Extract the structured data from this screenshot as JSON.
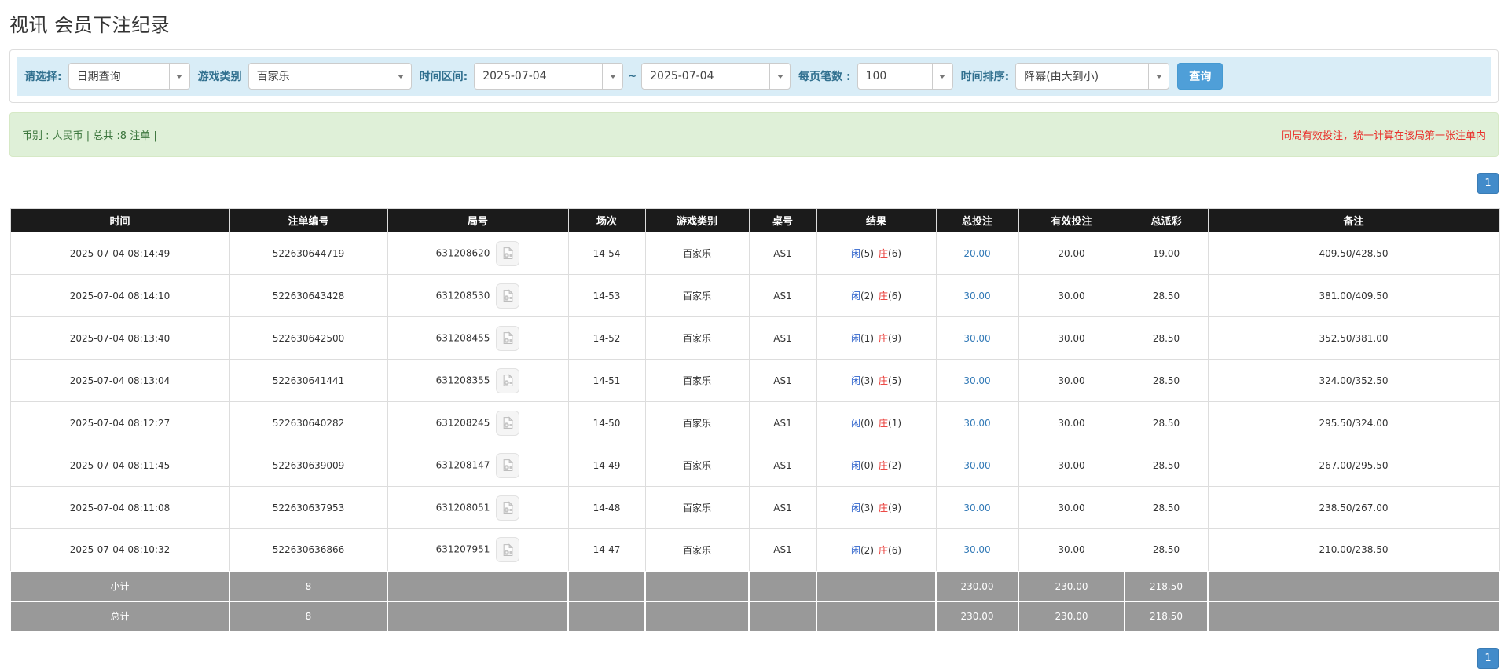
{
  "page": {
    "title": "视讯 会员下注纪录"
  },
  "filters": {
    "select_label": "请选择:",
    "select_value": "日期查询",
    "game_type_label": "游戏类别",
    "game_type_value": "百家乐",
    "time_range_label": "时间区间:",
    "date_from": "2025-07-04",
    "tilde": "~",
    "date_to": "2025-07-04",
    "page_size_label": "每页笔数 :",
    "page_size_value": "100",
    "sort_label": "时间排序:",
    "sort_value": "降幂(由大到小)",
    "search_button": "查询"
  },
  "summary_bar": {
    "left_text": "币别 : 人民币 | 总共 :8 注单 |",
    "right_text": "同局有效投注，统一计算在该局第一张注单内"
  },
  "pagination": {
    "page": "1"
  },
  "colors": {
    "accent_blue": "#4f9fd8",
    "pagination_blue": "#428bca",
    "filter_bar_bg": "#d9edf7",
    "filter_label": "#31708f",
    "success_bg": "#dff0d8",
    "success_text": "#3c763d",
    "notice_red": "#e9322d",
    "player_blue": "#3366cc",
    "banker_red": "#e9322d",
    "link_blue": "#337ab7",
    "table_header_bg": "#1b1b1b",
    "summary_row_bg": "#999999"
  },
  "table": {
    "headers": [
      "时间",
      "注单编号",
      "局号",
      "场次",
      "游戏类别",
      "桌号",
      "结果",
      "总投注",
      "有效投注",
      "总派彩",
      "备注"
    ],
    "rows": [
      {
        "time": "2025-07-04 08:14:49",
        "bet_id": "522630644719",
        "round_id": "631208620",
        "session": "14-54",
        "game": "百家乐",
        "table_no": "AS1",
        "player": "闲",
        "player_score": "(5)",
        "banker": "庄",
        "banker_score": "(6)",
        "total_bet": "20.00",
        "valid_bet": "20.00",
        "payout": "19.00",
        "remark": "409.50/428.50"
      },
      {
        "time": "2025-07-04 08:14:10",
        "bet_id": "522630643428",
        "round_id": "631208530",
        "session": "14-53",
        "game": "百家乐",
        "table_no": "AS1",
        "player": "闲",
        "player_score": "(2)",
        "banker": "庄",
        "banker_score": "(6)",
        "total_bet": "30.00",
        "valid_bet": "30.00",
        "payout": "28.50",
        "remark": "381.00/409.50"
      },
      {
        "time": "2025-07-04 08:13:40",
        "bet_id": "522630642500",
        "round_id": "631208455",
        "session": "14-52",
        "game": "百家乐",
        "table_no": "AS1",
        "player": "闲",
        "player_score": "(1)",
        "banker": "庄",
        "banker_score": "(9)",
        "total_bet": "30.00",
        "valid_bet": "30.00",
        "payout": "28.50",
        "remark": "352.50/381.00"
      },
      {
        "time": "2025-07-04 08:13:04",
        "bet_id": "522630641441",
        "round_id": "631208355",
        "session": "14-51",
        "game": "百家乐",
        "table_no": "AS1",
        "player": "闲",
        "player_score": "(3)",
        "banker": "庄",
        "banker_score": "(5)",
        "total_bet": "30.00",
        "valid_bet": "30.00",
        "payout": "28.50",
        "remark": "324.00/352.50"
      },
      {
        "time": "2025-07-04 08:12:27",
        "bet_id": "522630640282",
        "round_id": "631208245",
        "session": "14-50",
        "game": "百家乐",
        "table_no": "AS1",
        "player": "闲",
        "player_score": "(0)",
        "banker": "庄",
        "banker_score": "(1)",
        "total_bet": "30.00",
        "valid_bet": "30.00",
        "payout": "28.50",
        "remark": "295.50/324.00"
      },
      {
        "time": "2025-07-04 08:11:45",
        "bet_id": "522630639009",
        "round_id": "631208147",
        "session": "14-49",
        "game": "百家乐",
        "table_no": "AS1",
        "player": "闲",
        "player_score": "(0)",
        "banker": "庄",
        "banker_score": "(2)",
        "total_bet": "30.00",
        "valid_bet": "30.00",
        "payout": "28.50",
        "remark": "267.00/295.50"
      },
      {
        "time": "2025-07-04 08:11:08",
        "bet_id": "522630637953",
        "round_id": "631208051",
        "session": "14-48",
        "game": "百家乐",
        "table_no": "AS1",
        "player": "闲",
        "player_score": "(3)",
        "banker": "庄",
        "banker_score": "(9)",
        "total_bet": "30.00",
        "valid_bet": "30.00",
        "payout": "28.50",
        "remark": "238.50/267.00"
      },
      {
        "time": "2025-07-04 08:10:32",
        "bet_id": "522630636866",
        "round_id": "631207951",
        "session": "14-47",
        "game": "百家乐",
        "table_no": "AS1",
        "player": "闲",
        "player_score": "(2)",
        "banker": "庄",
        "banker_score": "(6)",
        "total_bet": "30.00",
        "valid_bet": "30.00",
        "payout": "28.50",
        "remark": "210.00/238.50"
      }
    ],
    "subtotal": {
      "label": "小计",
      "count": "8",
      "total_bet": "230.00",
      "valid_bet": "230.00",
      "payout": "218.50"
    },
    "total": {
      "label": "总计",
      "count": "8",
      "total_bet": "230.00",
      "valid_bet": "230.00",
      "payout": "218.50"
    }
  }
}
